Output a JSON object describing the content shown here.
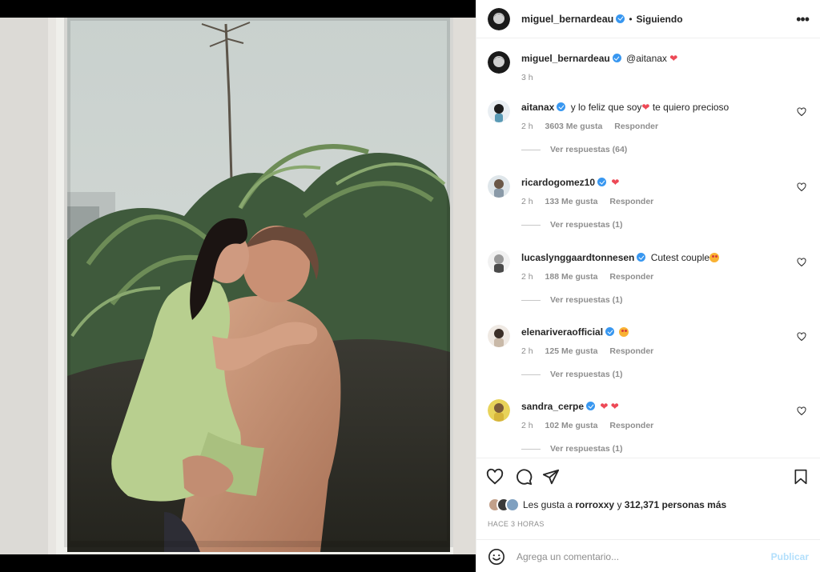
{
  "post": {
    "author": "miguel_bernardeau",
    "separator": "•",
    "follow_status": "Siguiendo",
    "more_icon": "more-horizontal-icon"
  },
  "caption": {
    "user": "miguel_bernardeau",
    "text": "@aitanax",
    "emoji": "❤",
    "time": "3 h"
  },
  "comments": [
    {
      "user": "aitanax",
      "text": "y lo feliz que soy",
      "emoji_mid": "❤",
      "text2": " te quiero precioso",
      "time": "2 h",
      "likes": "3603 Me gusta",
      "reply": "Responder",
      "replies": "Ver respuestas (64)",
      "avatar_color": "#5a9ab5"
    },
    {
      "user": "ricardogomez10",
      "text": "",
      "emoji_mid": "❤",
      "text2": "",
      "time": "2 h",
      "likes": "133 Me gusta",
      "reply": "Responder",
      "replies": "Ver respuestas (1)",
      "avatar_color": "#8a9aa8"
    },
    {
      "user": "lucaslynggaardtonnesen",
      "text": "Cutest couple",
      "emoji_mid": "",
      "text2": "",
      "time": "2 h",
      "likes": "188 Me gusta",
      "reply": "Responder",
      "replies": "Ver respuestas (1)",
      "avatar_color": "#6a6a6a"
    },
    {
      "user": "elenariveraofficial",
      "text": "",
      "emoji_mid": "",
      "text2": "",
      "time": "2 h",
      "likes": "125 Me gusta",
      "reply": "Responder",
      "replies": "Ver respuestas (1)",
      "avatar_color": "#c9b9a8"
    },
    {
      "user": "sandra_cerpe",
      "text": "",
      "emoji_mid": "❤ ❤",
      "text2": "",
      "time": "2 h",
      "likes": "102 Me gusta",
      "reply": "Responder",
      "replies": "Ver respuestas (1)",
      "avatar_color": "#d6b53a"
    }
  ],
  "actions": {
    "like_icon": "heart-icon",
    "comment_icon": "comment-icon",
    "share_icon": "share-icon",
    "save_icon": "bookmark-icon"
  },
  "likes": {
    "prefix": "Les gusta a",
    "user": "rorroxxy",
    "mid": "y",
    "count": "312,371 personas más"
  },
  "timestamp": "HACE 3 HORAS",
  "add_comment": {
    "placeholder": "Agrega un comentario...",
    "publish_label": "Publicar",
    "emoji_icon": "smiley-icon"
  },
  "colors": {
    "verified": "#3897f0",
    "heart": "#ed4956",
    "muted": "#8e8e8e",
    "publish": "#b2dffc"
  }
}
